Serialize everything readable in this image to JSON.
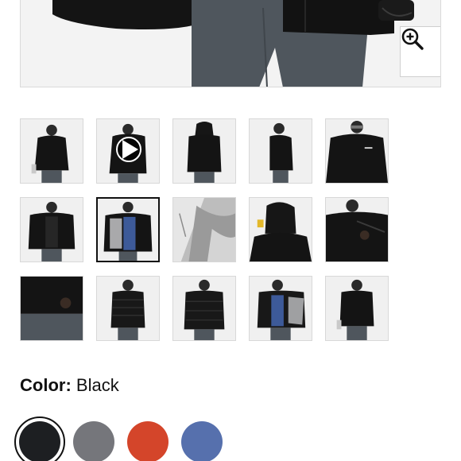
{
  "product": {
    "main_image_alt": "",
    "zoom_icon": "zoom-in-icon"
  },
  "gallery": {
    "thumbnails": [
      {
        "name": "thumb-front",
        "selected": false,
        "video": false
      },
      {
        "name": "thumb-video",
        "selected": false,
        "video": true,
        "icon": "play-icon"
      },
      {
        "name": "thumb-back",
        "selected": false,
        "video": false
      },
      {
        "name": "thumb-side",
        "selected": false,
        "video": false
      },
      {
        "name": "thumb-closeup-logo",
        "selected": false,
        "video": false
      },
      {
        "name": "thumb-open-front",
        "selected": false,
        "video": false
      },
      {
        "name": "thumb-open-lining",
        "selected": true,
        "video": false
      },
      {
        "name": "thumb-fabric-detail",
        "selected": false,
        "video": false
      },
      {
        "name": "thumb-hood-back",
        "selected": false,
        "video": false
      },
      {
        "name": "thumb-pocket-detail",
        "selected": false,
        "video": false
      },
      {
        "name": "thumb-cuff-detail",
        "selected": false,
        "video": false
      },
      {
        "name": "thumb-liner-front",
        "selected": false,
        "video": false
      },
      {
        "name": "thumb-liner-back",
        "selected": false,
        "video": false
      },
      {
        "name": "thumb-liner-open",
        "selected": false,
        "video": false
      },
      {
        "name": "thumb-full-front",
        "selected": false,
        "video": false
      }
    ]
  },
  "color": {
    "label": "Color:",
    "value": "Black",
    "swatches": [
      {
        "name": "swatch-black",
        "color": "#1d1f22",
        "selected": true
      },
      {
        "name": "swatch-grey",
        "color": "#75767b",
        "selected": false
      },
      {
        "name": "swatch-red",
        "color": "#d4452a",
        "selected": false
      },
      {
        "name": "swatch-blue",
        "color": "#5670ad",
        "selected": false
      }
    ]
  }
}
